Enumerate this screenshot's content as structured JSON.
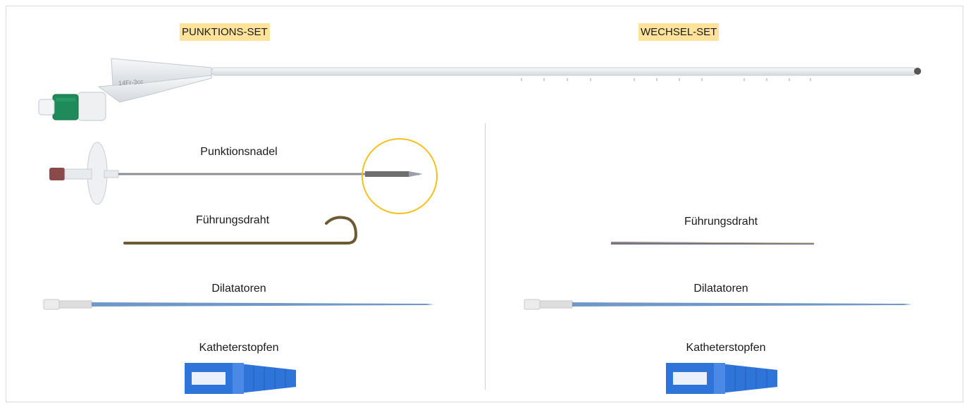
{
  "colors": {
    "highlight": "#ffe39a",
    "frame_border": "#d9d9d9",
    "divider": "#cfcfcf",
    "callout_ring": "#f2c21a",
    "catheter_hub_green": "#1f8a5a",
    "needle_hub": "#8a4a4a",
    "guidewire_bronze": "#6b5a34",
    "dilator_blue": "#6f97c8",
    "plug_blue": "#2f74d8"
  },
  "headers": {
    "left": "PUNKTIONS-SET",
    "right": "WECHSEL-SET"
  },
  "catheter": {
    "marking": "14Fr-3cc"
  },
  "left_set": {
    "needle_label": "Punktionsnadel",
    "guidewire_label": "Führungsdraht",
    "dilator_label": "Dilatatoren",
    "plug_label": "Katheterstopfen"
  },
  "right_set": {
    "guidewire_label": "Führungsdraht",
    "dilator_label": "Dilatatoren",
    "plug_label": "Katheterstopfen"
  },
  "icons": {
    "catheter": "balloon-catheter-image",
    "needle": "puncture-needle-image",
    "needle_zoom": "needle-tip-callout-circle",
    "guidewire_hooked": "hooked-guidewire-image",
    "guidewire_straight": "straight-guidewire-image",
    "dilator": "dilator-image",
    "plug": "catheter-plug-image"
  }
}
